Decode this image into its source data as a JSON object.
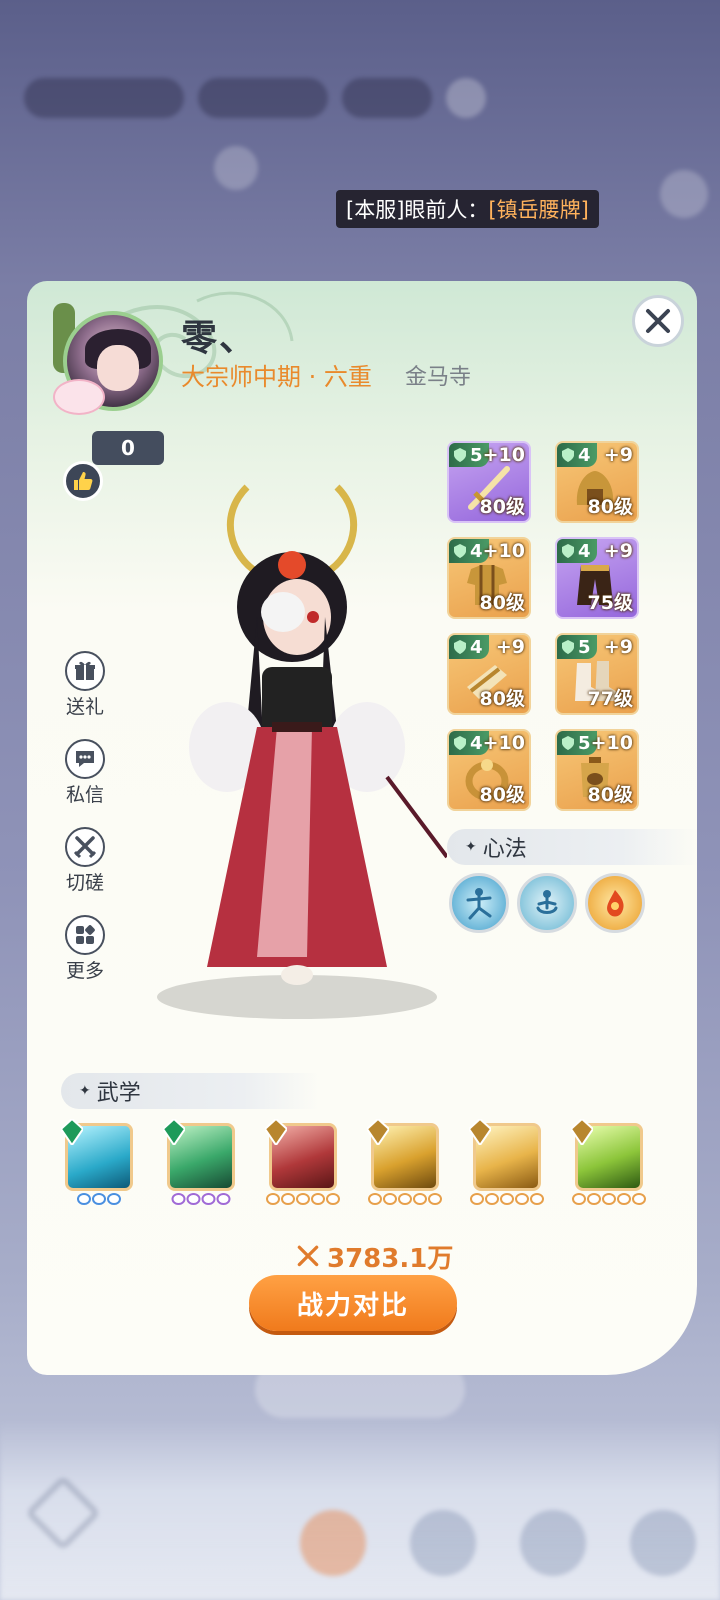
{
  "notice": {
    "prefix": "[本服]眼前人：",
    "item": "[镇岳腰牌]"
  },
  "profile": {
    "name": "零、",
    "rank": "大宗师中期 · 六重",
    "sect": "金马寺",
    "likes": "0"
  },
  "actions": [
    {
      "label": "送礼",
      "icon": "gift-icon"
    },
    {
      "label": "私信",
      "icon": "message-icon"
    },
    {
      "label": "切磋",
      "icon": "crossed-swords-icon"
    },
    {
      "label": "更多",
      "icon": "more-grid-icon"
    }
  ],
  "equipment": [
    {
      "stars": "5",
      "plus": "+10",
      "level": "80级",
      "rarity": "purple",
      "icon": "sword-icon"
    },
    {
      "stars": "4",
      "plus": "+9",
      "level": "80级",
      "rarity": "gold",
      "icon": "helmet-icon"
    },
    {
      "stars": "4",
      "plus": "+10",
      "level": "80级",
      "rarity": "gold",
      "icon": "armor-icon"
    },
    {
      "stars": "4",
      "plus": "+9",
      "level": "75级",
      "rarity": "purple",
      "icon": "pants-icon"
    },
    {
      "stars": "4",
      "plus": "+9",
      "level": "80级",
      "rarity": "gold",
      "icon": "bracer-icon"
    },
    {
      "stars": "5",
      "plus": "+9",
      "level": "77级",
      "rarity": "gold",
      "icon": "boots-icon"
    },
    {
      "stars": "4",
      "plus": "+10",
      "level": "80级",
      "rarity": "gold",
      "icon": "ring-icon"
    },
    {
      "stars": "5",
      "plus": "+10",
      "level": "80级",
      "rarity": "gold",
      "icon": "token-icon"
    }
  ],
  "xinfa": {
    "title": "心法",
    "items": [
      {
        "icon": "xinfa-stance-icon"
      },
      {
        "icon": "xinfa-meditation-icon"
      },
      {
        "icon": "xinfa-fire-icon"
      }
    ]
  },
  "wuxue": {
    "title": "武学",
    "skills": [
      {
        "icon": "skill-ice-icon",
        "gem": "green",
        "dots": "blue"
      },
      {
        "icon": "skill-leaf-icon",
        "gem": "green",
        "dots": "purple"
      },
      {
        "icon": "skill-blades-icon",
        "gem": "gold",
        "dots": "orange"
      },
      {
        "icon": "skill-golden-swords-icon",
        "gem": "gold",
        "dots": "orange"
      },
      {
        "icon": "skill-golden-strike-icon",
        "gem": "gold",
        "dots": "orange"
      },
      {
        "icon": "skill-wind-icon",
        "gem": "gold",
        "dots": "orange"
      }
    ]
  },
  "power": "3783.1万",
  "compare_button": "战力对比",
  "colors": {
    "accent": "#f07a1c",
    "rank": "#e98a2c",
    "notice_highlight": "#ffb25c"
  }
}
